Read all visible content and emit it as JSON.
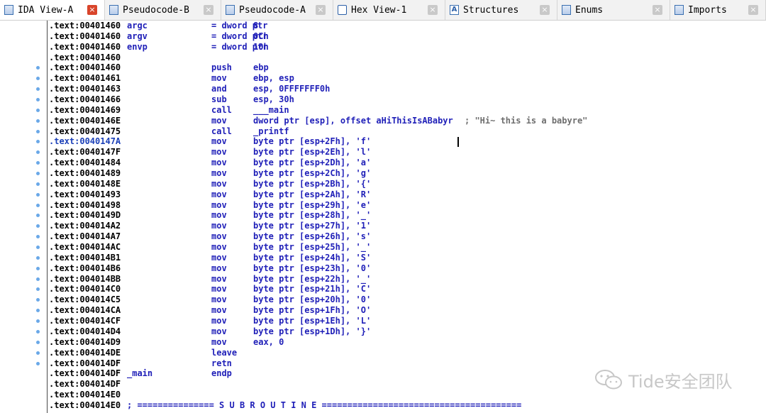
{
  "tabs": [
    {
      "label": "IDA View-A",
      "icon": "ida-view-icon",
      "active": true
    },
    {
      "label": "Pseudocode-B",
      "icon": "pseudocode-icon",
      "active": false
    },
    {
      "label": "Pseudocode-A",
      "icon": "pseudocode-icon",
      "active": false
    },
    {
      "label": "Hex View-1",
      "icon": "hex-view-icon",
      "active": false
    },
    {
      "label": "Structures",
      "icon": "structures-icon",
      "active": false
    },
    {
      "label": "Enums",
      "icon": "enums-icon",
      "active": false
    },
    {
      "label": "Imports",
      "icon": "imports-icon",
      "active": false
    }
  ],
  "listing": [
    {
      "addr": ".text:00401460",
      "label": "argc",
      "mnemonic": "= dword ptr",
      "operand": "8",
      "comment": "",
      "dot": false,
      "highlight": false
    },
    {
      "addr": ".text:00401460",
      "label": "argv",
      "mnemonic": "= dword ptr",
      "operand": "0Ch",
      "comment": "",
      "dot": false,
      "highlight": false
    },
    {
      "addr": ".text:00401460",
      "label": "envp",
      "mnemonic": "= dword ptr",
      "operand": "10h",
      "comment": "",
      "dot": false,
      "highlight": false
    },
    {
      "addr": ".text:00401460",
      "label": "",
      "mnemonic": "",
      "operand": "",
      "comment": "",
      "dot": false,
      "highlight": false
    },
    {
      "addr": ".text:00401460",
      "label": "",
      "mnemonic": "push",
      "operand": "ebp",
      "comment": "",
      "dot": true,
      "highlight": false
    },
    {
      "addr": ".text:00401461",
      "label": "",
      "mnemonic": "mov",
      "operand": "ebp, esp",
      "comment": "",
      "dot": true,
      "highlight": false
    },
    {
      "addr": ".text:00401463",
      "label": "",
      "mnemonic": "and",
      "operand": "esp, 0FFFFFFF0h",
      "comment": "",
      "dot": true,
      "highlight": false
    },
    {
      "addr": ".text:00401466",
      "label": "",
      "mnemonic": "sub",
      "operand": "esp, 30h",
      "comment": "",
      "dot": true,
      "highlight": false
    },
    {
      "addr": ".text:00401469",
      "label": "",
      "mnemonic": "call",
      "operand": "___main",
      "comment": "",
      "dot": true,
      "highlight": false
    },
    {
      "addr": ".text:0040146E",
      "label": "",
      "mnemonic": "mov",
      "operand": "dword ptr [esp], offset aHiThisIsABabyr",
      "comment": "; \"Hi~ this is a babyre\"",
      "dot": true,
      "highlight": false
    },
    {
      "addr": ".text:00401475",
      "label": "",
      "mnemonic": "call",
      "operand": "_printf",
      "comment": "",
      "dot": true,
      "highlight": false
    },
    {
      "addr": ".text:0040147A",
      "label": "",
      "mnemonic": "mov",
      "operand": "byte ptr [esp+2Fh], 'f'",
      "comment": "",
      "dot": true,
      "highlight": true
    },
    {
      "addr": ".text:0040147F",
      "label": "",
      "mnemonic": "mov",
      "operand": "byte ptr [esp+2Eh], 'l'",
      "comment": "",
      "dot": true,
      "highlight": false
    },
    {
      "addr": ".text:00401484",
      "label": "",
      "mnemonic": "mov",
      "operand": "byte ptr [esp+2Dh], 'a'",
      "comment": "",
      "dot": true,
      "highlight": false
    },
    {
      "addr": ".text:00401489",
      "label": "",
      "mnemonic": "mov",
      "operand": "byte ptr [esp+2Ch], 'g'",
      "comment": "",
      "dot": true,
      "highlight": false
    },
    {
      "addr": ".text:0040148E",
      "label": "",
      "mnemonic": "mov",
      "operand": "byte ptr [esp+2Bh], '{'",
      "comment": "",
      "dot": true,
      "highlight": false
    },
    {
      "addr": ".text:00401493",
      "label": "",
      "mnemonic": "mov",
      "operand": "byte ptr [esp+2Ah], 'R'",
      "comment": "",
      "dot": true,
      "highlight": false
    },
    {
      "addr": ".text:00401498",
      "label": "",
      "mnemonic": "mov",
      "operand": "byte ptr [esp+29h], 'e'",
      "comment": "",
      "dot": true,
      "highlight": false
    },
    {
      "addr": ".text:0040149D",
      "label": "",
      "mnemonic": "mov",
      "operand": "byte ptr [esp+28h], '_'",
      "comment": "",
      "dot": true,
      "highlight": false
    },
    {
      "addr": ".text:004014A2",
      "label": "",
      "mnemonic": "mov",
      "operand": "byte ptr [esp+27h], '1'",
      "comment": "",
      "dot": true,
      "highlight": false
    },
    {
      "addr": ".text:004014A7",
      "label": "",
      "mnemonic": "mov",
      "operand": "byte ptr [esp+26h], 's'",
      "comment": "",
      "dot": true,
      "highlight": false
    },
    {
      "addr": ".text:004014AC",
      "label": "",
      "mnemonic": "mov",
      "operand": "byte ptr [esp+25h], '_'",
      "comment": "",
      "dot": true,
      "highlight": false
    },
    {
      "addr": ".text:004014B1",
      "label": "",
      "mnemonic": "mov",
      "operand": "byte ptr [esp+24h], 'S'",
      "comment": "",
      "dot": true,
      "highlight": false
    },
    {
      "addr": ".text:004014B6",
      "label": "",
      "mnemonic": "mov",
      "operand": "byte ptr [esp+23h], '0'",
      "comment": "",
      "dot": true,
      "highlight": false
    },
    {
      "addr": ".text:004014BB",
      "label": "",
      "mnemonic": "mov",
      "operand": "byte ptr [esp+22h], '_'",
      "comment": "",
      "dot": true,
      "highlight": false
    },
    {
      "addr": ".text:004014C0",
      "label": "",
      "mnemonic": "mov",
      "operand": "byte ptr [esp+21h], 'C'",
      "comment": "",
      "dot": true,
      "highlight": false
    },
    {
      "addr": ".text:004014C5",
      "label": "",
      "mnemonic": "mov",
      "operand": "byte ptr [esp+20h], '0'",
      "comment": "",
      "dot": true,
      "highlight": false
    },
    {
      "addr": ".text:004014CA",
      "label": "",
      "mnemonic": "mov",
      "operand": "byte ptr [esp+1Fh], 'O'",
      "comment": "",
      "dot": true,
      "highlight": false
    },
    {
      "addr": ".text:004014CF",
      "label": "",
      "mnemonic": "mov",
      "operand": "byte ptr [esp+1Eh], 'L'",
      "comment": "",
      "dot": true,
      "highlight": false
    },
    {
      "addr": ".text:004014D4",
      "label": "",
      "mnemonic": "mov",
      "operand": "byte ptr [esp+1Dh], '}'",
      "comment": "",
      "dot": true,
      "highlight": false
    },
    {
      "addr": ".text:004014D9",
      "label": "",
      "mnemonic": "mov",
      "operand": "eax, 0",
      "comment": "",
      "dot": true,
      "highlight": false
    },
    {
      "addr": ".text:004014DE",
      "label": "",
      "mnemonic": "leave",
      "operand": "",
      "comment": "",
      "dot": true,
      "highlight": false
    },
    {
      "addr": ".text:004014DF",
      "label": "",
      "mnemonic": "retn",
      "operand": "",
      "comment": "",
      "dot": true,
      "highlight": false
    },
    {
      "addr": ".text:004014DF",
      "label": "_main",
      "mnemonic": "endp",
      "operand": "",
      "comment": "",
      "dot": false,
      "highlight": false
    },
    {
      "addr": ".text:004014DF",
      "label": "",
      "mnemonic": "",
      "operand": "",
      "comment": "",
      "dot": false,
      "highlight": false
    },
    {
      "addr": ".text:004014E0",
      "label": "",
      "mnemonic": "",
      "operand": "",
      "comment": "",
      "dot": false,
      "highlight": false
    },
    {
      "addr": ".text:004014E0",
      "label": "",
      "mnemonic": "",
      "operand": "",
      "comment": "",
      "dot": false,
      "highlight": false,
      "subroutine": "; =============== S U B R O U T I N E ======================================="
    }
  ],
  "watermark": {
    "text": "Tide安全团队",
    "icon": "wechat-icon"
  },
  "colors": {
    "keyword": "#1f1fb8",
    "address": "#000000",
    "comment": "#6e6e6e",
    "gutter_dot": "#6aa8e8",
    "active_close": "#d9452b"
  }
}
